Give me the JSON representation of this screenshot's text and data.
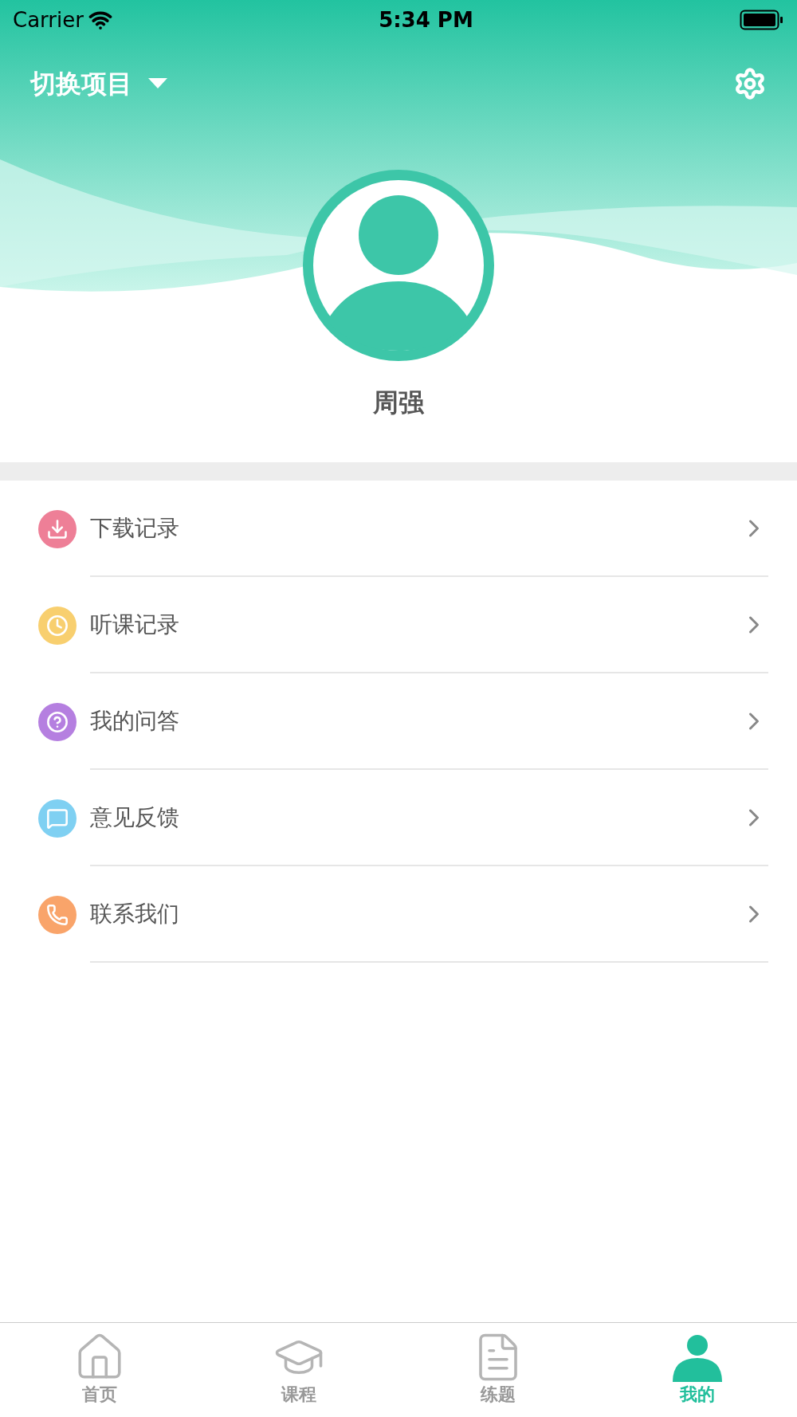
{
  "status_bar": {
    "carrier": "Carrier",
    "time": "5:34 PM"
  },
  "header": {
    "project_switcher": "切换项目"
  },
  "profile": {
    "name": "周强"
  },
  "menu": [
    {
      "label": "下载记录",
      "kind": "download",
      "color": "#ee7f97"
    },
    {
      "label": "听课记录",
      "kind": "clock",
      "color": "#f8cf6f"
    },
    {
      "label": "我的问答",
      "kind": "question",
      "color": "#b57fe0"
    },
    {
      "label": "意见反馈",
      "kind": "message",
      "color": "#7fd0f2"
    },
    {
      "label": "联系我们",
      "kind": "phone",
      "color": "#f9a46a"
    }
  ],
  "tabs": [
    {
      "label": "首页",
      "kind": "home",
      "selected": false
    },
    {
      "label": "课程",
      "kind": "course",
      "selected": false
    },
    {
      "label": "练题",
      "kind": "exercise",
      "selected": false
    },
    {
      "label": "我的",
      "kind": "mine",
      "selected": true
    }
  ]
}
